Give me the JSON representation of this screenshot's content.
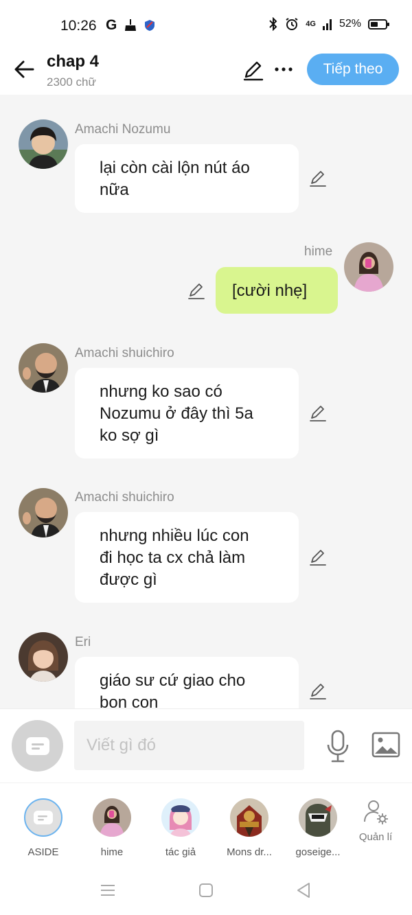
{
  "status_bar": {
    "time": "10:26",
    "network": "4G",
    "battery": "52%"
  },
  "header": {
    "title": "chap 4",
    "word_count": "2300 chữ",
    "next_label": "Tiếp theo"
  },
  "messages": [
    {
      "sender": "Amachi Nozumu",
      "side": "left",
      "lines": [
        "lại còn cài lộn nút áo",
        "nữa"
      ]
    },
    {
      "sender": "hime",
      "side": "right",
      "lines": [
        "[cười nhẹ]"
      ]
    },
    {
      "sender": "Amachi shuichiro",
      "side": "left",
      "lines": [
        "nhưng ko sao có",
        "Nozumu ở đây thì 5a",
        "ko sợ gì"
      ]
    },
    {
      "sender": "Amachi shuichiro",
      "side": "left",
      "lines": [
        "nhưng nhiều lúc con",
        "đi học ta cx chả làm",
        "được gì"
      ]
    },
    {
      "sender": "Eri",
      "side": "left",
      "lines": [
        "giáo sư cứ giao cho",
        "bọn con"
      ]
    }
  ],
  "input": {
    "placeholder": "Viết gì đó"
  },
  "characters": [
    {
      "label": "ASIDE"
    },
    {
      "label": "hime"
    },
    {
      "label": "tác giả"
    },
    {
      "label": "Mons dr..."
    },
    {
      "label": "goseige..."
    },
    {
      "label": "Quản lí"
    }
  ],
  "colors": {
    "accent": "#5aaef2",
    "my_bubble": "#d9f58f",
    "chat_background": "#f5f5f5"
  }
}
